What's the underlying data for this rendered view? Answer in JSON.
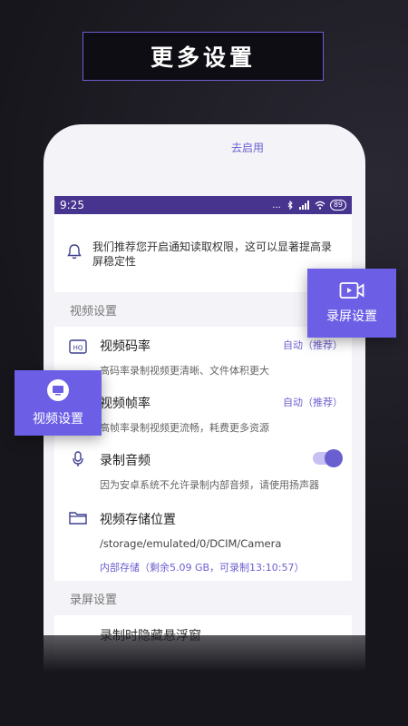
{
  "promo": {
    "title": "更多设置"
  },
  "statusbar": {
    "time": "9:25",
    "icons": "...",
    "battery": "89"
  },
  "notice": {
    "text": "我们推荐您开启通知读取权限，这可以显著提高录屏稳定性",
    "link": "去启用",
    "icon": "bell-icon"
  },
  "sections": {
    "video": "视频设置",
    "record": "录屏设置"
  },
  "rows": {
    "bitrate": {
      "title": "视频码率",
      "desc": "高码率录制视频更清晰、文件体积更大",
      "value": "自动（推荐）",
      "icon": "hq-icon"
    },
    "framerate": {
      "title": "视频帧率",
      "desc": "高帧率录制视频更流畅，耗费更多资源",
      "value": "自动（推荐）",
      "icon": "framerate-icon"
    },
    "audio": {
      "title": "录制音频",
      "desc": "因为安卓系统不允许录制内部音频，请使用扬声器",
      "icon": "microphone-icon",
      "enabled": true
    },
    "storage": {
      "title": "视频存储位置",
      "path": "/storage/emulated/0/DCIM/Camera",
      "info": "内部存储（剩余5.09 GB，可录制13:10:57）",
      "icon": "folder-icon"
    },
    "partial": {
      "title": "录制时隐藏悬浮窗"
    }
  },
  "cards": {
    "record": {
      "label": "录屏设置",
      "icon": "video-camera-icon"
    },
    "video": {
      "label": "视频设置",
      "icon": "monitor-icon"
    }
  },
  "colors": {
    "accent": "#6c5fe6",
    "statusbar": "#47348f",
    "background": "#17161c"
  }
}
